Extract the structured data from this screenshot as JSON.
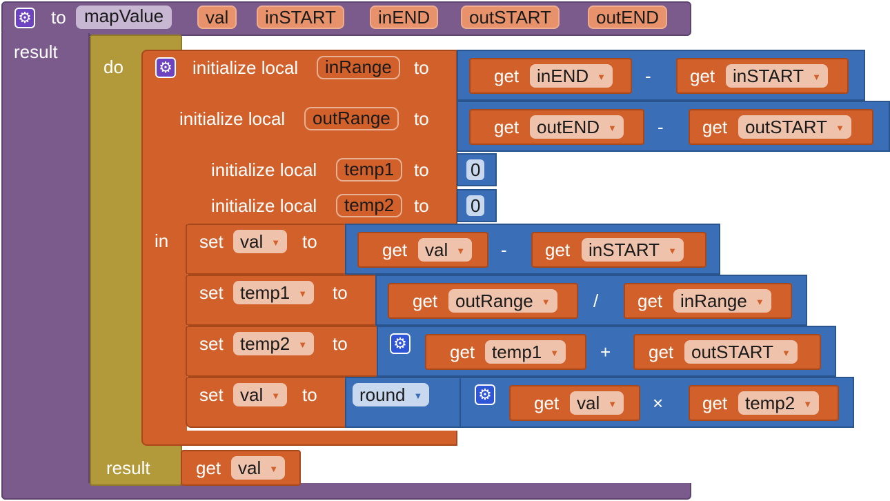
{
  "header": {
    "to": "to",
    "name": "mapValue",
    "params": [
      "val",
      "inSTART",
      "inEND",
      "outSTART",
      "outEND"
    ],
    "result_label": "result"
  },
  "do_block": {
    "do_label": "do",
    "in_label": "in",
    "result_label": "result"
  },
  "locals": [
    {
      "prefix": "initialize local",
      "name": "inRange",
      "to": "to",
      "get_a": "inEND",
      "op": "-",
      "get_b": "inSTART"
    },
    {
      "prefix": "initialize local",
      "name": "outRange",
      "to": "to",
      "get_a": "outEND",
      "op": "-",
      "get_b": "outSTART"
    },
    {
      "prefix": "initialize local",
      "name": "temp1",
      "to": "to",
      "value": "0"
    },
    {
      "prefix": "initialize local",
      "name": "temp2",
      "to": "to",
      "value": "0"
    }
  ],
  "sets": [
    {
      "set": "set",
      "var": "val",
      "to": "to",
      "get_a": "val",
      "op": "-",
      "get_b": "inSTART"
    },
    {
      "set": "set",
      "var": "temp1",
      "to": "to",
      "get_a": "outRange",
      "op": "/",
      "get_b": "inRange"
    },
    {
      "set": "set",
      "var": "temp2",
      "to": "to",
      "get_a": "temp1",
      "op": "+",
      "get_b": "outSTART"
    },
    {
      "set": "set",
      "var": "val",
      "to": "to",
      "round": "round",
      "get_a": "val",
      "op": "×",
      "get_b": "temp2"
    }
  ],
  "get_word": "get",
  "result_get": "val",
  "colors": {
    "procedure": "#7b5a8c",
    "do": "#b29a3a",
    "variable": "#d2602a",
    "math": "#3a6fb8",
    "mutator": "#6d43c2"
  },
  "icons": {
    "mutator": "gear-icon",
    "dropdown": "triangle-down-icon"
  }
}
